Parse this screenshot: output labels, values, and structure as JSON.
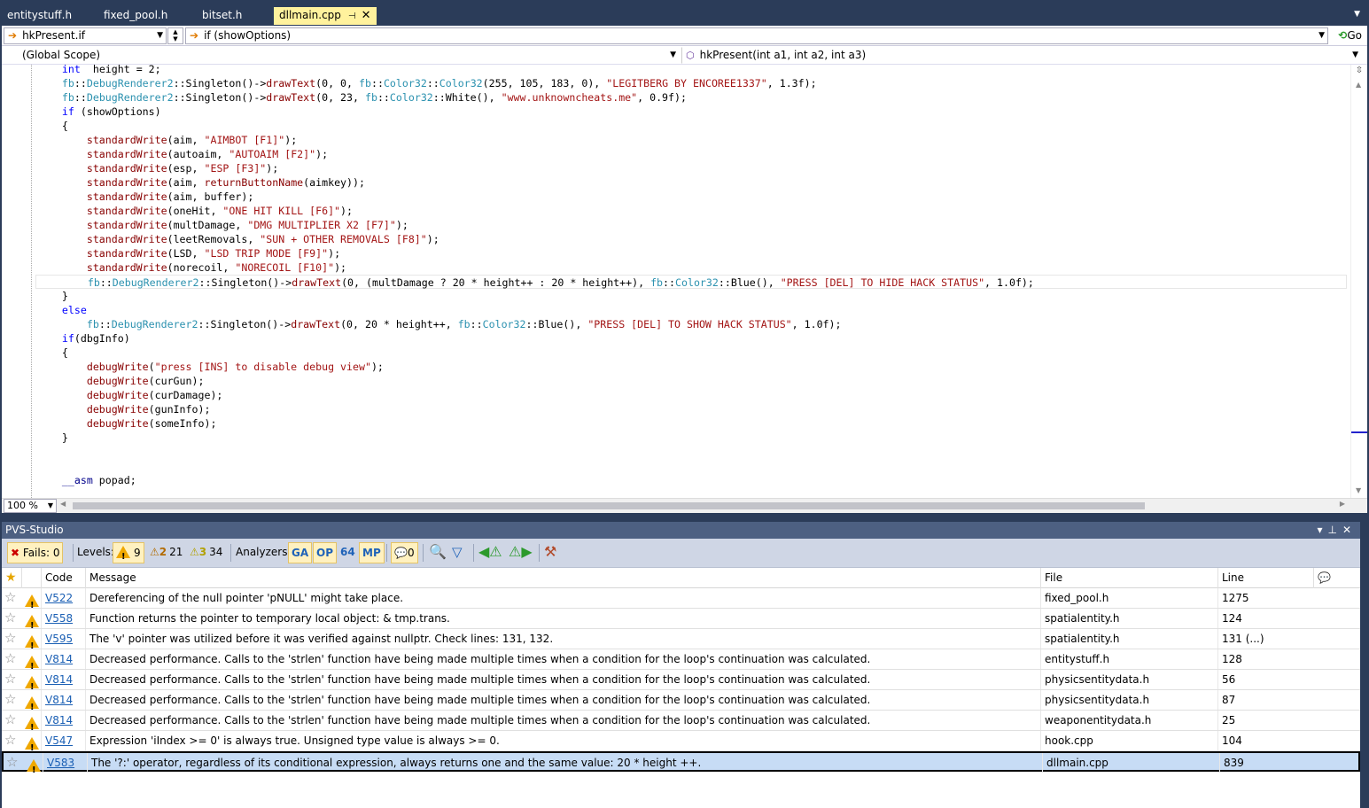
{
  "tabs": [
    {
      "label": "entitystuff.h",
      "active": false
    },
    {
      "label": "fixed_pool.h",
      "active": false
    },
    {
      "label": "bitset.h",
      "active": false
    },
    {
      "label": "dllmain.cpp",
      "active": true
    }
  ],
  "nav": {
    "find_combo": "hkPresent.if",
    "find_text": "if (showOptions)",
    "go_label": "Go",
    "scope": "(Global Scope)",
    "member": "hkPresent(int a1, int a2, int a3)"
  },
  "code": [
    [
      [
        "kw",
        "    int"
      ],
      [
        "",
        "  height = 2;"
      ]
    ],
    [
      [
        "ns",
        "    fb"
      ],
      [
        "",
        "::"
      ],
      [
        "ns",
        "DebugRenderer2"
      ],
      [
        "",
        "::Singleton()->"
      ],
      [
        "fn",
        "drawText"
      ],
      [
        "",
        "(0, 0, "
      ],
      [
        "ns",
        "fb"
      ],
      [
        "",
        "::"
      ],
      [
        "ns",
        "Color32"
      ],
      [
        "",
        "::"
      ],
      [
        "ns",
        "Color32"
      ],
      [
        "",
        "(255, 105, 183, 0), "
      ],
      [
        "str",
        "\"LEGITBERG BY ENCOREE1337\""
      ],
      [
        "",
        ", 1.3f);"
      ]
    ],
    [
      [
        "ns",
        "    fb"
      ],
      [
        "",
        "::"
      ],
      [
        "ns",
        "DebugRenderer2"
      ],
      [
        "",
        "::Singleton()->"
      ],
      [
        "fn",
        "drawText"
      ],
      [
        "",
        "(0, 23, "
      ],
      [
        "ns",
        "fb"
      ],
      [
        "",
        "::"
      ],
      [
        "ns",
        "Color32"
      ],
      [
        "",
        "::White(), "
      ],
      [
        "str",
        "\"www.unknowncheats.me\""
      ],
      [
        "",
        ", 0.9f);"
      ]
    ],
    [
      [
        "kw",
        "    if"
      ],
      [
        "",
        " (showOptions)"
      ]
    ],
    [
      [
        "",
        "    {"
      ]
    ],
    [
      [
        "fn",
        "        standardWrite"
      ],
      [
        "",
        "(aim, "
      ],
      [
        "str",
        "\"AIMBOT [F1]\""
      ],
      [
        "",
        ");"
      ]
    ],
    [
      [
        "fn",
        "        standardWrite"
      ],
      [
        "",
        "(autoaim, "
      ],
      [
        "str",
        "\"AUTOAIM [F2]\""
      ],
      [
        "",
        ");"
      ]
    ],
    [
      [
        "fn",
        "        standardWrite"
      ],
      [
        "",
        "(esp, "
      ],
      [
        "str",
        "\"ESP [F3]\""
      ],
      [
        "",
        ");"
      ]
    ],
    [
      [
        "fn",
        "        standardWrite"
      ],
      [
        "",
        "(aim, "
      ],
      [
        "fn",
        "returnButtonName"
      ],
      [
        "",
        "(aimkey));"
      ]
    ],
    [
      [
        "fn",
        "        standardWrite"
      ],
      [
        "",
        "(aim, buffer);"
      ]
    ],
    [
      [
        "fn",
        "        standardWrite"
      ],
      [
        "",
        "(oneHit, "
      ],
      [
        "str",
        "\"ONE HIT KILL [F6]\""
      ],
      [
        "",
        ");"
      ]
    ],
    [
      [
        "fn",
        "        standardWrite"
      ],
      [
        "",
        "(multDamage, "
      ],
      [
        "str",
        "\"DMG MULTIPLIER X2 [F7]\""
      ],
      [
        "",
        ");"
      ]
    ],
    [
      [
        "fn",
        "        standardWrite"
      ],
      [
        "",
        "(leetRemovals, "
      ],
      [
        "str",
        "\"SUN + OTHER REMOVALS [F8]\""
      ],
      [
        "",
        ");"
      ]
    ],
    [
      [
        "fn",
        "        standardWrite"
      ],
      [
        "",
        "(LSD, "
      ],
      [
        "str",
        "\"LSD TRIP MODE [F9]\""
      ],
      [
        "",
        ");"
      ]
    ],
    [
      [
        "fn",
        "        standardWrite"
      ],
      [
        "",
        "(norecoil, "
      ],
      [
        "str",
        "\"NORECOIL [F10]\""
      ],
      [
        "",
        ");"
      ]
    ],
    [
      [
        "ns",
        "        fb"
      ],
      [
        "",
        "::"
      ],
      [
        "ns",
        "DebugRenderer2"
      ],
      [
        "",
        "::Singleton()->"
      ],
      [
        "fn",
        "drawText"
      ],
      [
        "",
        "(0, (multDamage ? 20 * height++ : 20 * height++), "
      ],
      [
        "ns",
        "fb"
      ],
      [
        "",
        "::"
      ],
      [
        "ns",
        "Color32"
      ],
      [
        "",
        "::Blue(), "
      ],
      [
        "str",
        "\"PRESS [DEL] TO HIDE HACK STATUS\""
      ],
      [
        "",
        ", 1.0f);"
      ]
    ],
    [
      [
        "",
        "    }"
      ]
    ],
    [
      [
        "kw",
        "    else"
      ]
    ],
    [
      [
        "ns",
        "        fb"
      ],
      [
        "",
        "::"
      ],
      [
        "ns",
        "DebugRenderer2"
      ],
      [
        "",
        "::Singleton()->"
      ],
      [
        "fn",
        "drawText"
      ],
      [
        "",
        "(0, 20 * height++, "
      ],
      [
        "ns",
        "fb"
      ],
      [
        "",
        "::"
      ],
      [
        "ns",
        "Color32"
      ],
      [
        "",
        "::Blue(), "
      ],
      [
        "str",
        "\"PRESS [DEL] TO SHOW HACK STATUS\""
      ],
      [
        "",
        ", 1.0f);"
      ]
    ],
    [
      [
        "kw",
        "    if"
      ],
      [
        "",
        ""
      ],
      [
        "",
        ""
      ],
      [
        "",
        "(dbgInfo)"
      ]
    ],
    [
      [
        "",
        "    {"
      ]
    ],
    [
      [
        "fn",
        "        debugWrite"
      ],
      [
        "",
        "("
      ],
      [
        "str",
        "\"press [INS] to disable debug view\""
      ],
      [
        "",
        ");"
      ]
    ],
    [
      [
        "fn",
        "        debugWrite"
      ],
      [
        "",
        "(curGun);"
      ]
    ],
    [
      [
        "fn",
        "        debugWrite"
      ],
      [
        "",
        "(curDamage);"
      ]
    ],
    [
      [
        "fn",
        "        debugWrite"
      ],
      [
        "",
        "(gunInfo);"
      ]
    ],
    [
      [
        "fn",
        "        debugWrite"
      ],
      [
        "",
        "(someInfo);"
      ]
    ],
    [
      [
        "",
        "    }"
      ]
    ],
    [
      [
        "",
        ""
      ]
    ],
    [
      [
        "",
        ""
      ]
    ],
    [
      [
        "asm",
        "    __asm"
      ],
      [
        "",
        " popad;"
      ]
    ]
  ],
  "current_line_index": 15,
  "zoom": "100 %",
  "pvs": {
    "title": "PVS-Studio",
    "fails_label": "Fails: 0",
    "levels_label": "Levels:",
    "level1_count": "9",
    "level2_count": "21",
    "level3_count": "34",
    "analyzers_label": "Analyzers:",
    "analyzers": [
      "GA",
      "OP",
      "64",
      "MP"
    ],
    "comments_count": "0",
    "columns": [
      "Code",
      "Message",
      "File",
      "Line"
    ],
    "rows": [
      {
        "code": "V522",
        "message": "Dereferencing of the null pointer 'pNULL' might take place.",
        "file": "fixed_pool.h",
        "line": "1275"
      },
      {
        "code": "V558",
        "message": "Function returns the pointer to temporary local object: & tmp.trans.",
        "file": "spatialentity.h",
        "line": "124"
      },
      {
        "code": "V595",
        "message": "The 'v' pointer was utilized before it was verified against nullptr. Check lines: 131, 132.",
        "file": "spatialentity.h",
        "line": "131 (...)"
      },
      {
        "code": "V814",
        "message": "Decreased performance. Calls to the 'strlen' function have being made multiple times when a condition for the loop's continuation was calculated.",
        "file": "entitystuff.h",
        "line": "128"
      },
      {
        "code": "V814",
        "message": "Decreased performance. Calls to the 'strlen' function have being made multiple times when a condition for the loop's continuation was calculated.",
        "file": "physicsentitydata.h",
        "line": "56"
      },
      {
        "code": "V814",
        "message": "Decreased performance. Calls to the 'strlen' function have being made multiple times when a condition for the loop's continuation was calculated.",
        "file": "physicsentitydata.h",
        "line": "87"
      },
      {
        "code": "V814",
        "message": "Decreased performance. Calls to the 'strlen' function have being made multiple times when a condition for the loop's continuation was calculated.",
        "file": "weaponentitydata.h",
        "line": "25"
      },
      {
        "code": "V547",
        "message": "Expression 'iIndex >= 0' is always true. Unsigned type value is always >= 0.",
        "file": "hook.cpp",
        "line": "104"
      },
      {
        "code": "V583",
        "message": "The '?:' operator, regardless of its conditional expression, always returns one and the same value: 20 * height ++.",
        "file": "dllmain.cpp",
        "line": "839",
        "selected": true
      }
    ]
  }
}
